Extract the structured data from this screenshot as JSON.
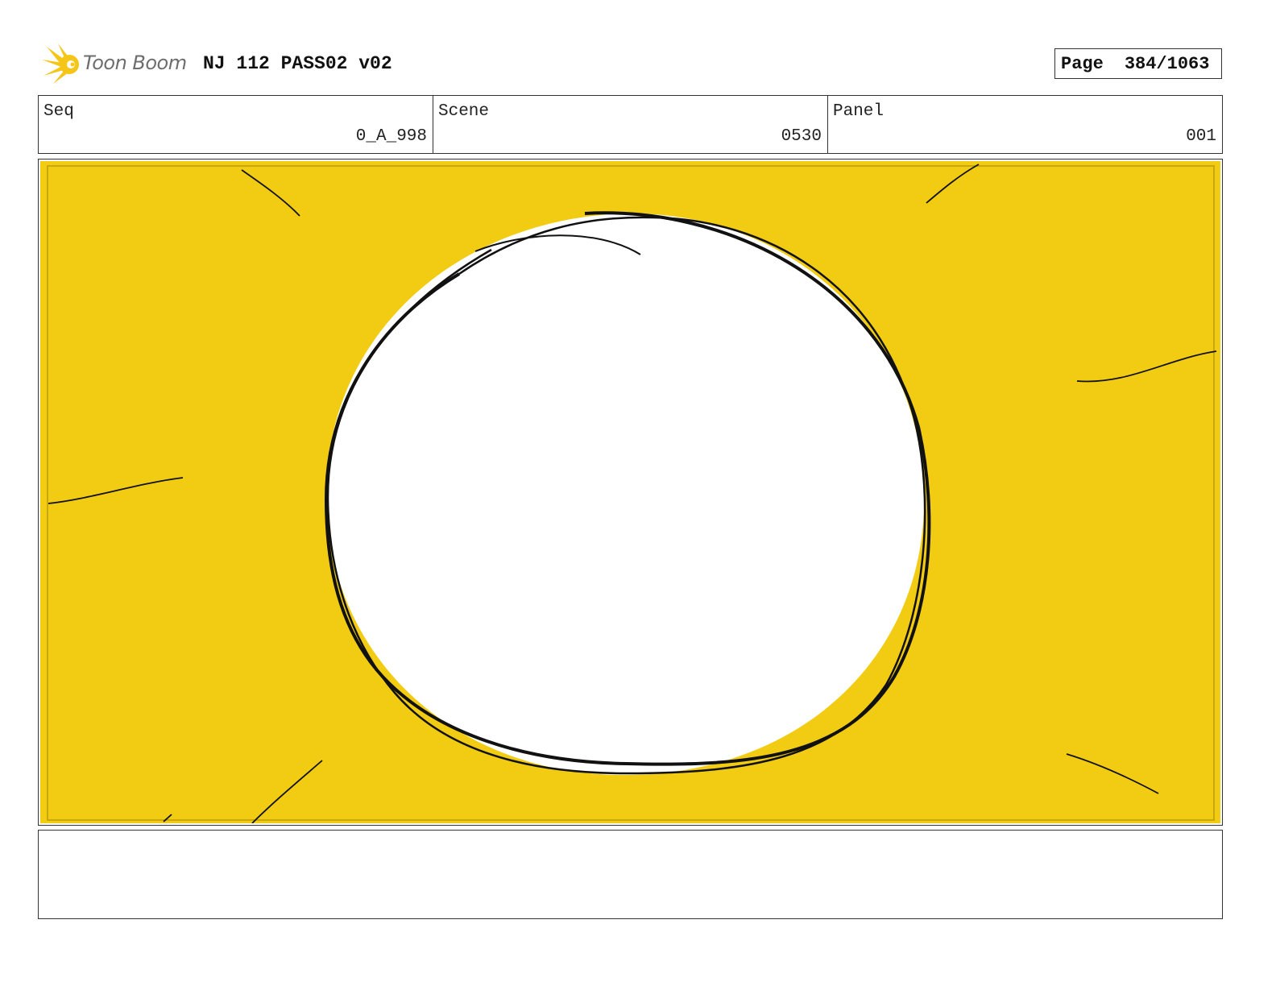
{
  "header": {
    "logo_text": "Toon Boom",
    "project_title": "NJ 112 PASS02 v02",
    "page_label": "Page",
    "page_number": "384/1063"
  },
  "info": {
    "seq_label": "Seq",
    "seq_value": "0_A_998",
    "scene_label": "Scene",
    "scene_value": "0530",
    "panel_label": "Panel",
    "panel_value": "001"
  },
  "panel": {
    "background_color": "#f2cc12",
    "border_color": "#c9a70e",
    "circle_color": "#ffffff",
    "line_color": "#111111"
  },
  "notes": {
    "text": ""
  }
}
